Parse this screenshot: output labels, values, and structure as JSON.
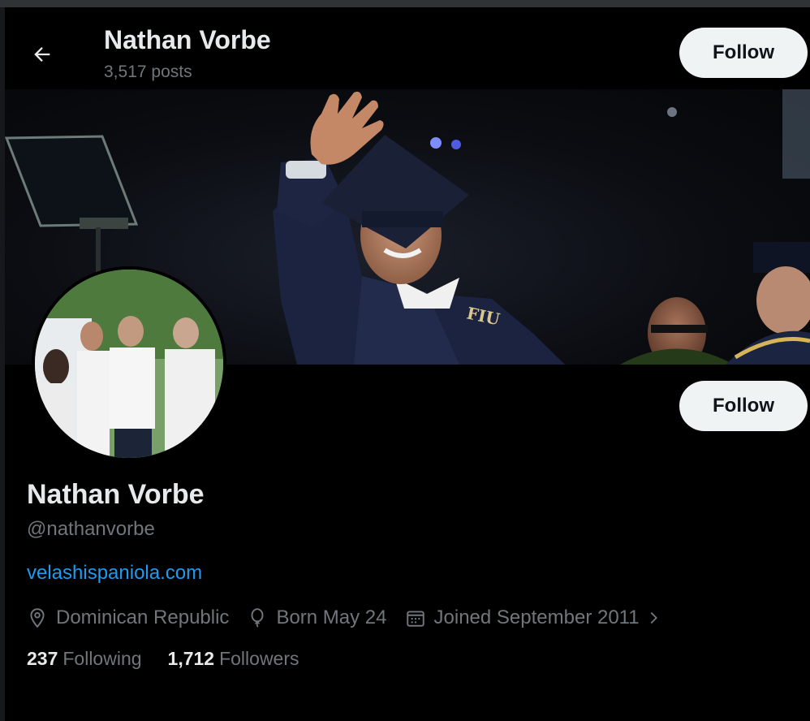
{
  "header": {
    "name": "Nathan Vorbe",
    "posts_count": "3,517 posts",
    "follow_label": "Follow"
  },
  "profile": {
    "display_name": "Nathan Vorbe",
    "handle": "@nathanvorbe",
    "website": "velashispaniola.com",
    "location": "Dominican Republic",
    "birthday": "Born May 24",
    "joined": "Joined September 2011",
    "follow_label": "Follow",
    "following_count": "237",
    "following_label": "Following",
    "followers_count": "1,712",
    "followers_label": "Followers"
  },
  "banner": {
    "cap_text": "FIU"
  },
  "icons": {
    "back": "arrow-left-icon",
    "location": "location-pin-icon",
    "birthday": "balloon-icon",
    "joined": "calendar-icon",
    "more": "chevron-right-icon"
  },
  "colors": {
    "background": "#000000",
    "text_primary": "#e7e9ea",
    "text_secondary": "#71767b",
    "link": "#1d9bf0",
    "button_bg": "#eff3f4",
    "button_text": "#0f1419"
  }
}
